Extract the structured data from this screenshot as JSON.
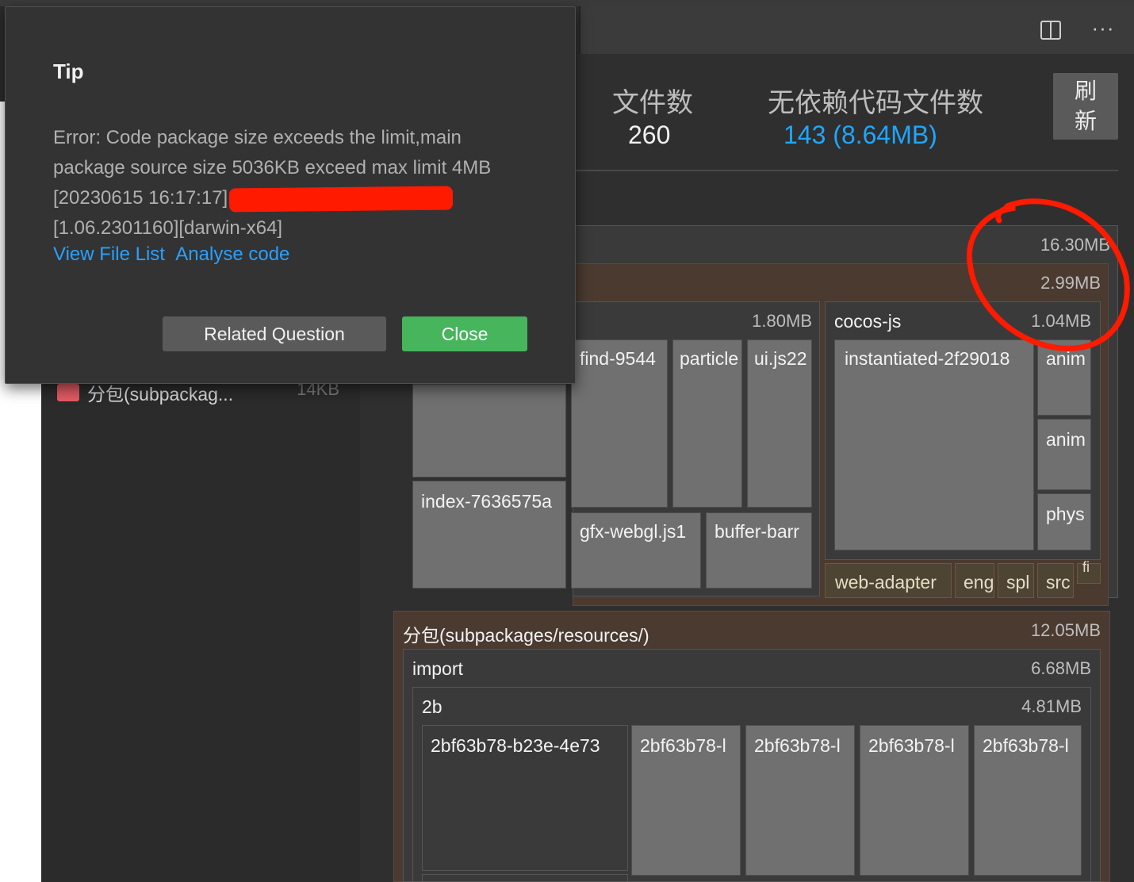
{
  "stats": {
    "file_count_label": "文件数",
    "file_count_value": "260",
    "no_dep_label": "无依赖代码文件数",
    "no_dep_value": "143 (8.64MB)",
    "refresh_label": "刷\n新",
    "accent_color": "#1ea7ff"
  },
  "sidebar": {
    "item_label": "分包(subpackag...",
    "item_size": "14KB",
    "item_icon": "folder-icon"
  },
  "toolbar": {
    "split_icon": "split-editor-icon",
    "more_icon": "more-icon",
    "more_glyph": "···"
  },
  "treemap": {
    "root_size": "16.30MB",
    "main_size": "2.99MB",
    "group1_size": "1.80MB",
    "cocos_label": "cocos-js",
    "cocos_size": "1.04MB",
    "find": "find-9544",
    "particle": "particle",
    "uijs": "ui.js22",
    "index": "index-7636575a",
    "gfx": "gfx-webgl.js1",
    "buffer": "buffer-barr",
    "instantiated": "instantiated-2f29018",
    "anim1": "anim",
    "anim2": "anim",
    "phys": "phys",
    "web_adapter": "web-adapter",
    "eng": "eng",
    "spl": "spl",
    "src": "src",
    "fi": "fi",
    "sub_label": "分包(subpackages/resources/)",
    "sub_size": "12.05MB",
    "import_label": "import",
    "import_size": "6.68MB",
    "b2_label": "2b",
    "b2_size": "4.81MB",
    "f1": "2bf63b78-b23e-4e73",
    "f2": "2bf63b78-l",
    "f3": "2bf63b78-l",
    "f4": "2bf63b78-l",
    "f5": "2bf63b78-l"
  },
  "dialog": {
    "title": "Tip",
    "line1": "Error: Code package size exceeds the limit,main",
    "line2": "package source size 5036KB exceed max limit 4MB",
    "line3": "[20230615 16:17:17]",
    "line4": "[1.06.2301160][darwin-x64]",
    "link_view": "View File List",
    "link_analyse": "Analyse code",
    "related_button": "Related Question",
    "close_button": "Close",
    "annotation_color": "#ff1a00"
  }
}
